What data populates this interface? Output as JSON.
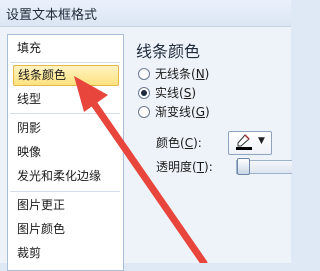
{
  "window": {
    "title": "设置文本框格式"
  },
  "categories": [
    {
      "label": "填充",
      "selected": false
    },
    {
      "label": "线条颜色",
      "selected": true
    },
    {
      "label": "线型",
      "selected": false
    },
    {
      "label": "阴影",
      "selected": false
    },
    {
      "label": "映像",
      "selected": false
    },
    {
      "label": "发光和柔化边缘",
      "selected": false
    },
    {
      "label": "图片更正",
      "selected": false
    },
    {
      "label": "图片颜色",
      "selected": false
    },
    {
      "label": "裁剪",
      "selected": false
    }
  ],
  "panel": {
    "heading": "线条颜色",
    "options": [
      {
        "label": "无线条(",
        "key": "N",
        "suffix": ")",
        "checked": false
      },
      {
        "label": "实线(",
        "key": "S",
        "suffix": ")",
        "checked": true
      },
      {
        "label": "渐变线(",
        "key": "G",
        "suffix": ")",
        "checked": false
      }
    ],
    "color_label": {
      "text": "颜色(",
      "key": "C",
      "suffix": "):"
    },
    "transparency_label": {
      "text": "透明度(",
      "key": "T",
      "suffix": "):"
    },
    "selected_color": "#000000"
  },
  "annotation": {
    "arrow_color": "#e8463c"
  },
  "icons": {
    "pen": "pen-color-icon",
    "dropdown": "chevron-down-icon"
  }
}
